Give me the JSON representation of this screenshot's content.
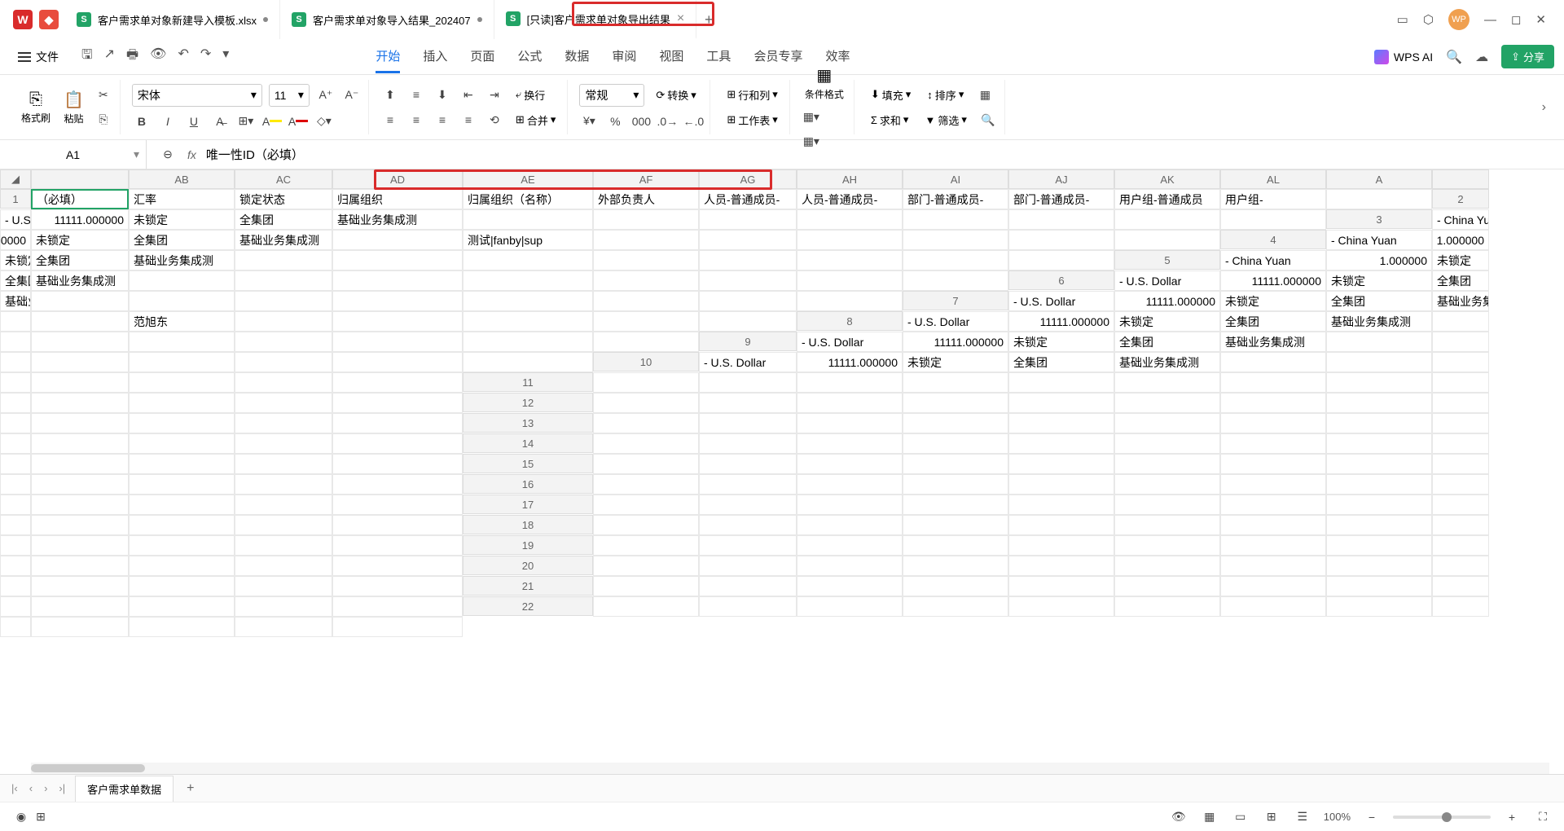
{
  "titlebar": {
    "tabs": [
      {
        "title": "客户需求单对象新建导入模板.xlsx",
        "modified": true,
        "active": false
      },
      {
        "title": "客户需求单对象导入结果_202407",
        "modified": true,
        "active": false
      },
      {
        "title": "[只读]客户需求单对象导出结果",
        "modified": false,
        "active": true
      }
    ],
    "avatar": "WP"
  },
  "menubar": {
    "file": "文件",
    "tabs": [
      "开始",
      "插入",
      "页面",
      "公式",
      "数据",
      "审阅",
      "视图",
      "工具",
      "会员专享",
      "效率"
    ],
    "active_tab": "开始",
    "wps_ai": "WPS AI",
    "share": "分享"
  },
  "ribbon": {
    "format_painter": "格式刷",
    "paste": "粘贴",
    "font_name": "宋体",
    "font_size": "11",
    "number_format": "常规",
    "wrap": "换行",
    "merge": "合并",
    "convert": "转换",
    "rowcol": "行和列",
    "worksheet": "工作表",
    "cond_format": "条件格式",
    "fill": "填充",
    "sort": "排序",
    "sum": "求和",
    "filter": "筛选"
  },
  "formula_bar": {
    "cell_ref": "A1",
    "formula": "唯一性ID（必填）"
  },
  "grid": {
    "columns": [
      "AB",
      "AC",
      "AD",
      "AE",
      "AF",
      "AG",
      "AH",
      "AI",
      "AJ",
      "AK",
      "AL",
      "A"
    ],
    "row_count": 22,
    "headers": {
      "AB": "（必填）",
      "AC": "汇率",
      "AD": "锁定状态",
      "AE": "归属组织",
      "AF": "归属组织（名称）",
      "AG": "外部负责人",
      "AH": "人员-普通成员-",
      "AI": "人员-普通成员-",
      "AJ": "部门-普通成员-",
      "AK": "部门-普通成员-",
      "AL": "用户组-普通成员",
      "AM": "用户组-"
    },
    "rows": [
      {
        "AB": "- U.S. Dollar",
        "AC": "11111.000000",
        "AD": "未锁定",
        "AE": "全集团",
        "AF": "基础业务集成测",
        "AG": "",
        "AH": "",
        "AI": ""
      },
      {
        "AB": "- China Yuan",
        "AC": "1.000000",
        "AD": "未锁定",
        "AE": "全集团",
        "AF": "基础业务集成测",
        "AG": "",
        "AH": "测试|fanby|sup",
        "AI": ""
      },
      {
        "AB": "- China Yuan",
        "AC": "1.000000",
        "AD": "未锁定",
        "AE": "全集团",
        "AF": "基础业务集成测",
        "AG": "",
        "AH": "",
        "AI": ""
      },
      {
        "AB": "- China Yuan",
        "AC": "1.000000",
        "AD": "未锁定",
        "AE": "全集团",
        "AF": "基础业务集成测",
        "AG": "",
        "AH": "",
        "AI": ""
      },
      {
        "AB": "- U.S. Dollar",
        "AC": "11111.000000",
        "AD": "未锁定",
        "AE": "全集团",
        "AF": "基础业务集成测",
        "AG": "",
        "AH": "",
        "AI": ""
      },
      {
        "AB": "- U.S. Dollar",
        "AC": "11111.000000",
        "AD": "未锁定",
        "AE": "全集团",
        "AF": "基础业务集成测",
        "AG": "",
        "AH": "",
        "AI": "范旭东"
      },
      {
        "AB": "- U.S. Dollar",
        "AC": "11111.000000",
        "AD": "未锁定",
        "AE": "全集团",
        "AF": "基础业务集成测",
        "AG": "",
        "AH": "",
        "AI": ""
      },
      {
        "AB": "- U.S. Dollar",
        "AC": "11111.000000",
        "AD": "未锁定",
        "AE": "全集团",
        "AF": "基础业务集成测",
        "AG": "",
        "AH": "",
        "AI": ""
      },
      {
        "AB": "- U.S. Dollar",
        "AC": "11111.000000",
        "AD": "未锁定",
        "AE": "全集团",
        "AF": "基础业务集成测",
        "AG": "",
        "AH": "",
        "AI": ""
      }
    ]
  },
  "sheet_bar": {
    "active_sheet": "客户需求单数据"
  },
  "status_bar": {
    "zoom": "100%"
  }
}
